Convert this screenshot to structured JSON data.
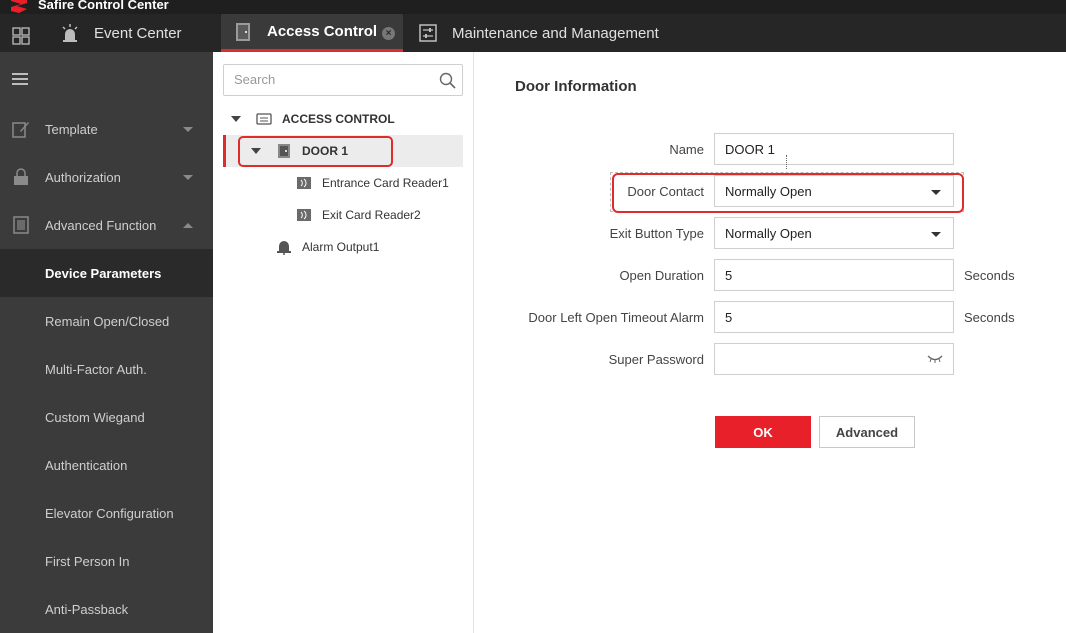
{
  "app": {
    "title": "Safire Control Center"
  },
  "tabs": [
    {
      "label": "Event Center"
    },
    {
      "label": "Access Control",
      "active": true
    },
    {
      "label": "Maintenance and Management"
    }
  ],
  "sidebar": {
    "groups": [
      {
        "label": "Template",
        "expanded": false
      },
      {
        "label": "Authorization",
        "expanded": false
      },
      {
        "label": "Advanced Function",
        "expanded": true
      }
    ],
    "subitems": [
      {
        "label": "Device Parameters",
        "active": true
      },
      {
        "label": "Remain Open/Closed"
      },
      {
        "label": "Multi-Factor Auth."
      },
      {
        "label": "Custom Wiegand"
      },
      {
        "label": "Authentication"
      },
      {
        "label": "Elevator Configuration"
      },
      {
        "label": "First Person In"
      },
      {
        "label": "Anti-Passback"
      }
    ]
  },
  "tree": {
    "search_placeholder": "Search",
    "root": "ACCESS CONTROL",
    "door": "DOOR 1",
    "readers": [
      "Entrance Card Reader1",
      "Exit Card Reader2"
    ],
    "alarm": "Alarm Output1"
  },
  "form": {
    "title": "Door Information",
    "fields": {
      "name": {
        "label": "Name",
        "value": "DOOR 1"
      },
      "door_contact": {
        "label": "Door Contact",
        "value": "Normally Open"
      },
      "exit_button_type": {
        "label": "Exit Button Type",
        "value": "Normally Open"
      },
      "open_duration": {
        "label": "Open Duration",
        "value": "5",
        "unit": "Seconds"
      },
      "door_left_open_timeout": {
        "label": "Door Left Open Timeout Alarm",
        "value": "5",
        "unit": "Seconds"
      },
      "super_password": {
        "label": "Super Password",
        "value": ""
      }
    },
    "ok_label": "OK",
    "advanced_label": "Advanced"
  },
  "colors": {
    "accent": "#e8202a",
    "sidebar_bg": "#3b3b3b",
    "titlebar_bg": "#1f1f1f"
  }
}
